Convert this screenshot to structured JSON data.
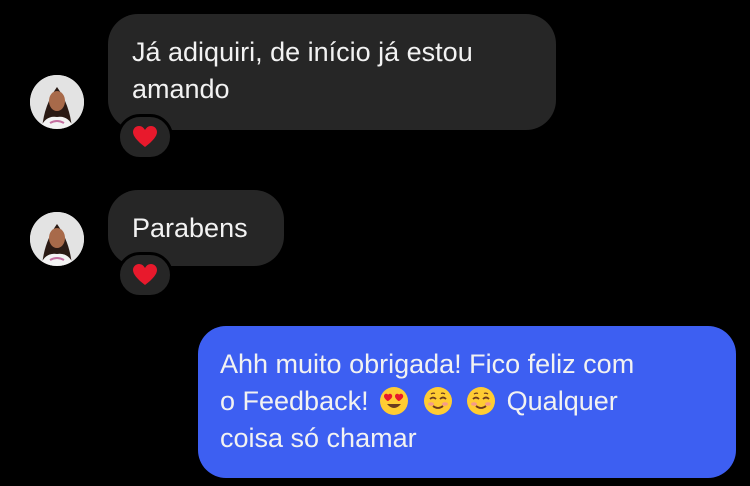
{
  "conversation": {
    "messages": [
      {
        "direction": "incoming",
        "lines": [
          "Já adiquiri, de início já estou",
          "amando"
        ],
        "reaction": "heart-emoji"
      },
      {
        "direction": "incoming",
        "lines": [
          "Parabens"
        ],
        "reaction": "heart-emoji"
      },
      {
        "direction": "outgoing",
        "line1": "Ahh muito obrigada! Fico feliz com",
        "line2_text": "o Feedback!",
        "line2_emojis": [
          "heart-eyes-emoji",
          "smiling-blush-emoji",
          "smiling-blush-emoji"
        ],
        "line2_tail": "Qualquer",
        "line3": "coisa só chamar"
      }
    ]
  },
  "colors": {
    "background": "#000000",
    "incoming_bubble": "#262626",
    "outgoing_bubble": "#3d5ff2",
    "text": "#f2f2f2",
    "heart": "#e8192c"
  }
}
